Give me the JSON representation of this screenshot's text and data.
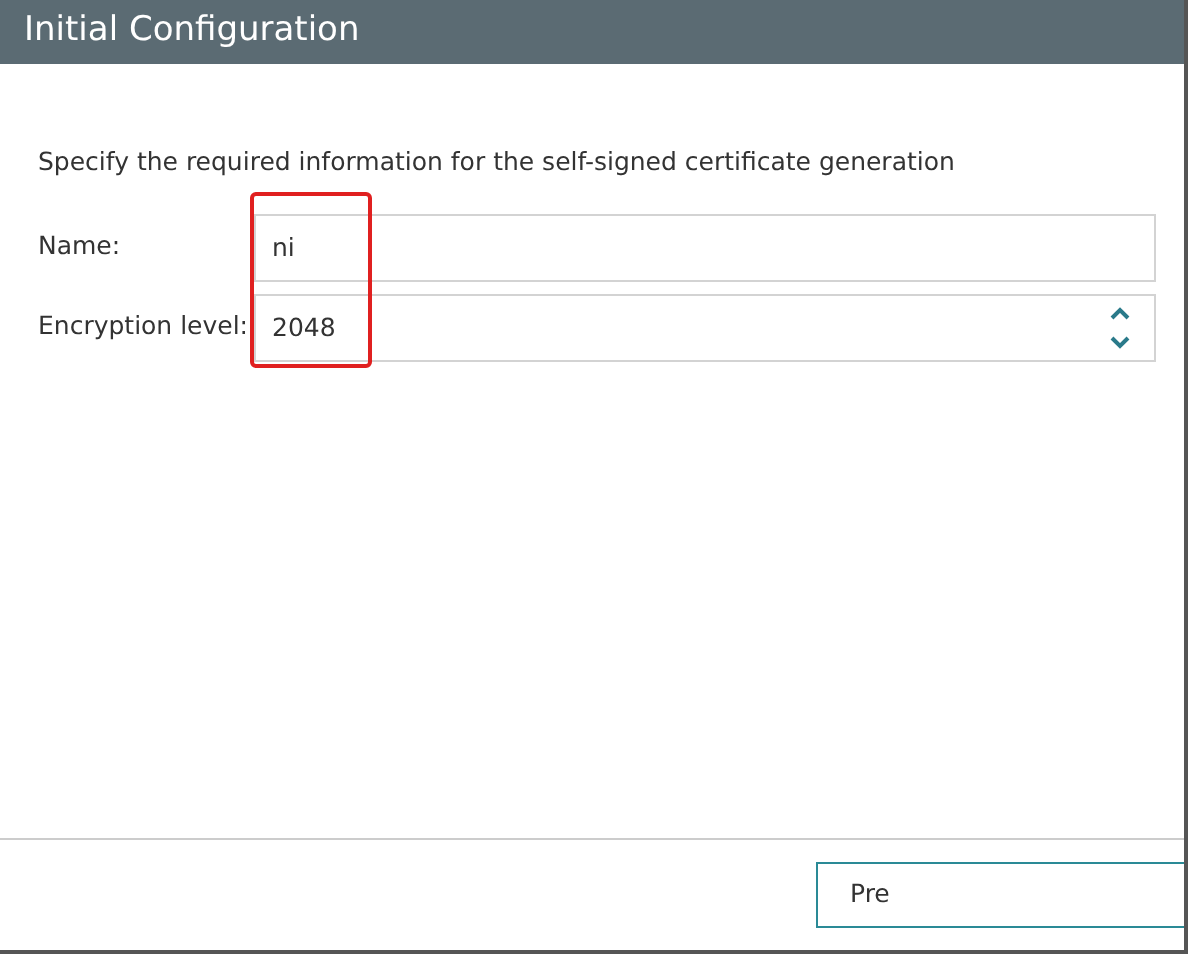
{
  "window": {
    "title": "Initial Configuration"
  },
  "instruction": "Specify the required information for the self-signed certificate generation",
  "fields": [
    {
      "label": "Name:",
      "value": "ni",
      "kind": "text"
    },
    {
      "label": "Encryption level:",
      "value": "2048",
      "kind": "spinner"
    }
  ],
  "buttons": [
    "Pre"
  ]
}
